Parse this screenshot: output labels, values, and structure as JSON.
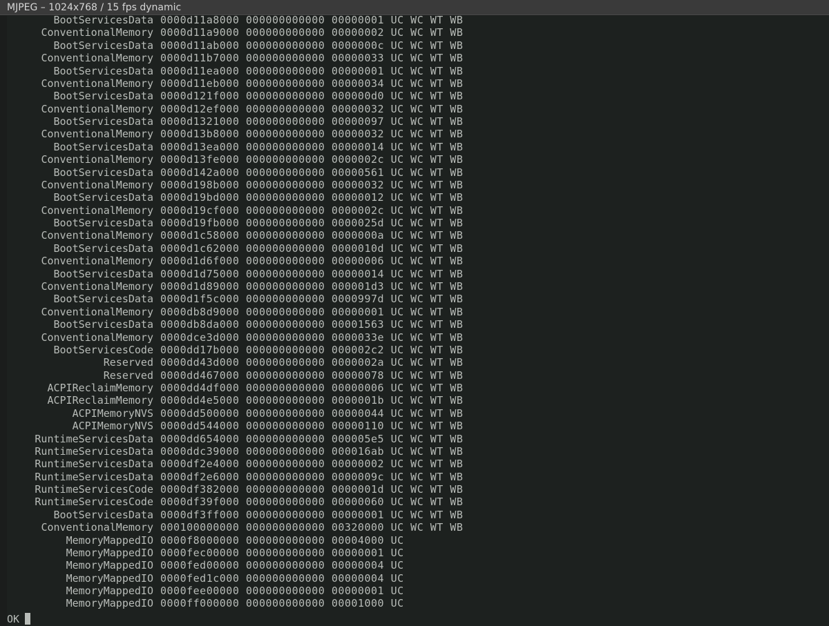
{
  "window": {
    "title": "MJPEG – 1024x768 / 15 fps dynamic"
  },
  "console": {
    "rows": [
      [
        "BootServicesData",
        "0000d11a8000",
        "000000000000",
        "00000001",
        "UC WC WT WB"
      ],
      [
        "ConventionalMemory",
        "0000d11a9000",
        "000000000000",
        "00000002",
        "UC WC WT WB"
      ],
      [
        "BootServicesData",
        "0000d11ab000",
        "000000000000",
        "0000000c",
        "UC WC WT WB"
      ],
      [
        "ConventionalMemory",
        "0000d11b7000",
        "000000000000",
        "00000033",
        "UC WC WT WB"
      ],
      [
        "BootServicesData",
        "0000d11ea000",
        "000000000000",
        "00000001",
        "UC WC WT WB"
      ],
      [
        "ConventionalMemory",
        "0000d11eb000",
        "000000000000",
        "00000034",
        "UC WC WT WB"
      ],
      [
        "BootServicesData",
        "0000d121f000",
        "000000000000",
        "000000d0",
        "UC WC WT WB"
      ],
      [
        "ConventionalMemory",
        "0000d12ef000",
        "000000000000",
        "00000032",
        "UC WC WT WB"
      ],
      [
        "BootServicesData",
        "0000d1321000",
        "000000000000",
        "00000097",
        "UC WC WT WB"
      ],
      [
        "ConventionalMemory",
        "0000d13b8000",
        "000000000000",
        "00000032",
        "UC WC WT WB"
      ],
      [
        "BootServicesData",
        "0000d13ea000",
        "000000000000",
        "00000014",
        "UC WC WT WB"
      ],
      [
        "ConventionalMemory",
        "0000d13fe000",
        "000000000000",
        "0000002c",
        "UC WC WT WB"
      ],
      [
        "BootServicesData",
        "0000d142a000",
        "000000000000",
        "00000561",
        "UC WC WT WB"
      ],
      [
        "ConventionalMemory",
        "0000d198b000",
        "000000000000",
        "00000032",
        "UC WC WT WB"
      ],
      [
        "BootServicesData",
        "0000d19bd000",
        "000000000000",
        "00000012",
        "UC WC WT WB"
      ],
      [
        "ConventionalMemory",
        "0000d19cf000",
        "000000000000",
        "0000002c",
        "UC WC WT WB"
      ],
      [
        "BootServicesData",
        "0000d19fb000",
        "000000000000",
        "0000025d",
        "UC WC WT WB"
      ],
      [
        "ConventionalMemory",
        "0000d1c58000",
        "000000000000",
        "0000000a",
        "UC WC WT WB"
      ],
      [
        "BootServicesData",
        "0000d1c62000",
        "000000000000",
        "0000010d",
        "UC WC WT WB"
      ],
      [
        "ConventionalMemory",
        "0000d1d6f000",
        "000000000000",
        "00000006",
        "UC WC WT WB"
      ],
      [
        "BootServicesData",
        "0000d1d75000",
        "000000000000",
        "00000014",
        "UC WC WT WB"
      ],
      [
        "ConventionalMemory",
        "0000d1d89000",
        "000000000000",
        "000001d3",
        "UC WC WT WB"
      ],
      [
        "BootServicesData",
        "0000d1f5c000",
        "000000000000",
        "0000997d",
        "UC WC WT WB"
      ],
      [
        "ConventionalMemory",
        "0000db8d9000",
        "000000000000",
        "00000001",
        "UC WC WT WB"
      ],
      [
        "BootServicesData",
        "0000db8da000",
        "000000000000",
        "00001563",
        "UC WC WT WB"
      ],
      [
        "ConventionalMemory",
        "0000dce3d000",
        "000000000000",
        "0000033e",
        "UC WC WT WB"
      ],
      [
        "BootServicesCode",
        "0000dd17b000",
        "000000000000",
        "000002c2",
        "UC WC WT WB"
      ],
      [
        "Reserved",
        "0000dd43d000",
        "000000000000",
        "0000002a",
        "UC WC WT WB"
      ],
      [
        "Reserved",
        "0000dd467000",
        "000000000000",
        "00000078",
        "UC WC WT WB"
      ],
      [
        "ACPIReclaimMemory",
        "0000dd4df000",
        "000000000000",
        "00000006",
        "UC WC WT WB"
      ],
      [
        "ACPIReclaimMemory",
        "0000dd4e5000",
        "000000000000",
        "0000001b",
        "UC WC WT WB"
      ],
      [
        "ACPIMemoryNVS",
        "0000dd500000",
        "000000000000",
        "00000044",
        "UC WC WT WB"
      ],
      [
        "ACPIMemoryNVS",
        "0000dd544000",
        "000000000000",
        "00000110",
        "UC WC WT WB"
      ],
      [
        "RuntimeServicesData",
        "0000dd654000",
        "000000000000",
        "000005e5",
        "UC WC WT WB"
      ],
      [
        "RuntimeServicesData",
        "0000ddc39000",
        "000000000000",
        "000016ab",
        "UC WC WT WB"
      ],
      [
        "RuntimeServicesData",
        "0000df2e4000",
        "000000000000",
        "00000002",
        "UC WC WT WB"
      ],
      [
        "RuntimeServicesData",
        "0000df2e6000",
        "000000000000",
        "0000009c",
        "UC WC WT WB"
      ],
      [
        "RuntimeServicesCode",
        "0000df382000",
        "000000000000",
        "0000001d",
        "UC WC WT WB"
      ],
      [
        "RuntimeServicesCode",
        "0000df39f000",
        "000000000000",
        "00000060",
        "UC WC WT WB"
      ],
      [
        "BootServicesData",
        "0000df3ff000",
        "000000000000",
        "00000001",
        "UC WC WT WB"
      ],
      [
        "ConventionalMemory",
        "000100000000",
        "000000000000",
        "00320000",
        "UC WC WT WB"
      ],
      [
        "MemoryMappedIO",
        "0000f8000000",
        "000000000000",
        "00004000",
        "UC"
      ],
      [
        "MemoryMappedIO",
        "0000fec00000",
        "000000000000",
        "00000001",
        "UC"
      ],
      [
        "MemoryMappedIO",
        "0000fed00000",
        "000000000000",
        "00000004",
        "UC"
      ],
      [
        "MemoryMappedIO",
        "0000fed1c000",
        "000000000000",
        "00000004",
        "UC"
      ],
      [
        "MemoryMappedIO",
        "0000fee00000",
        "000000000000",
        "00000001",
        "UC"
      ],
      [
        "MemoryMappedIO",
        "0000ff000000",
        "000000000000",
        "00001000",
        "UC"
      ]
    ],
    "prompt": "OK"
  }
}
